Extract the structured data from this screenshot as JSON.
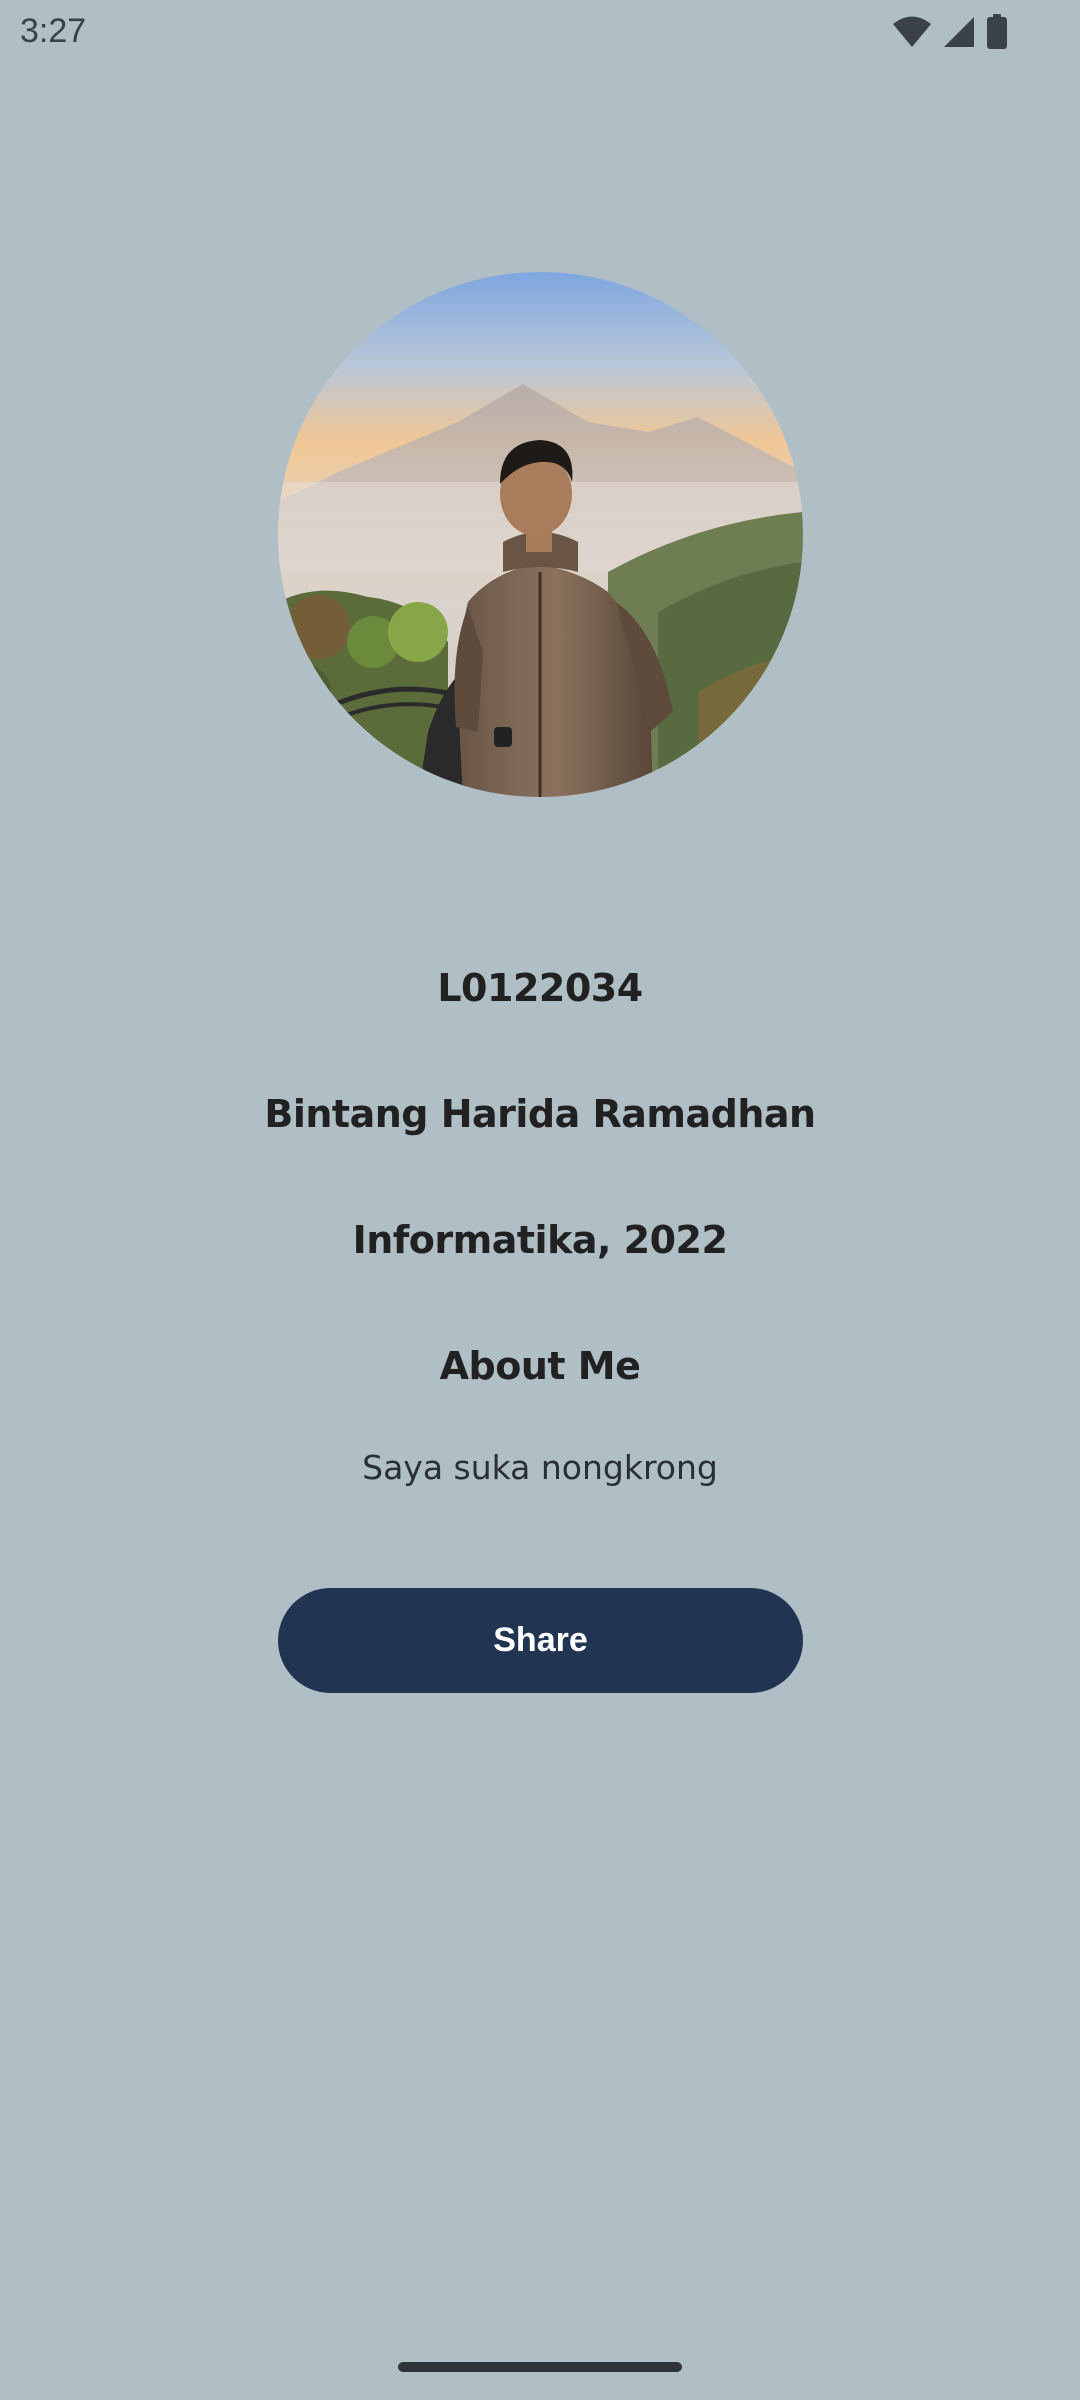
{
  "status_bar": {
    "time": "3:27",
    "icons": [
      "wifi-icon",
      "cellular-signal-icon",
      "battery-icon"
    ]
  },
  "profile": {
    "avatar": "profile-photo",
    "id": "L0122034",
    "name": "Bintang Harida Ramadhan",
    "major": "Informatika, 2022",
    "about_heading": "About Me",
    "about_text": "Saya suka nongkrong"
  },
  "actions": {
    "share_label": "Share"
  },
  "colors": {
    "background": "#b0bec5",
    "button": "#213553",
    "button_text": "#ffffff",
    "text": "#212121"
  }
}
